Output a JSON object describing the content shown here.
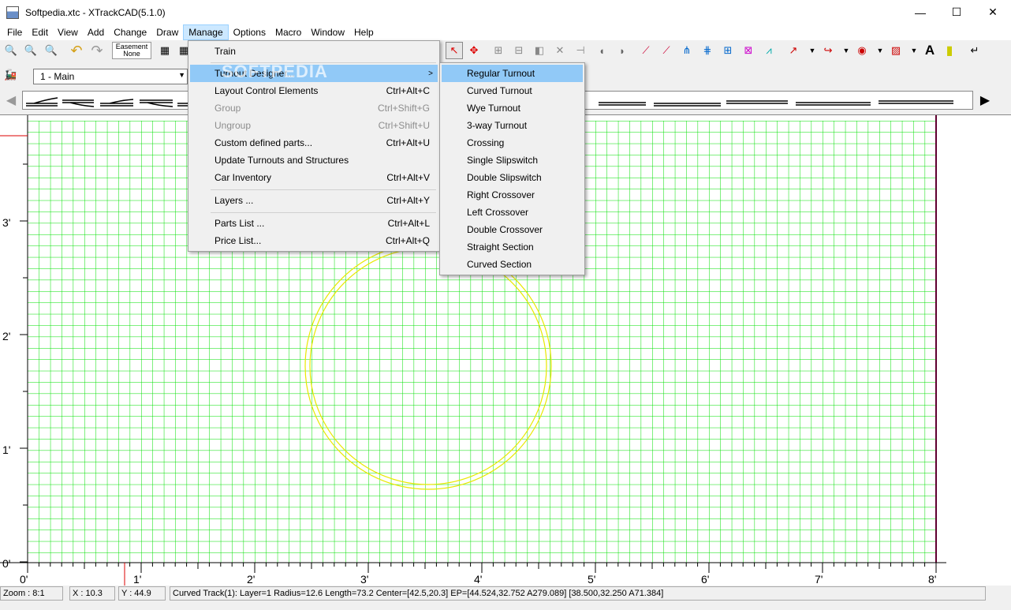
{
  "window": {
    "title": "Softpedia.xtc - XTrackCAD(5.1.0)",
    "minimize": "—",
    "maximize": "☐",
    "close": "✕"
  },
  "menubar": [
    "File",
    "Edit",
    "View",
    "Add",
    "Change",
    "Draw",
    "Manage",
    "Options",
    "Macro",
    "Window",
    "Help"
  ],
  "toolbar": {
    "easement_title": "Easement",
    "easement_value": "None"
  },
  "layer": {
    "selected": "1 - Main"
  },
  "manage_menu": {
    "items": [
      {
        "label": "Train",
        "shortcut": ""
      },
      {
        "label": "Turnout Designer...",
        "shortcut": ""
      },
      {
        "label": "Layout Control Elements",
        "shortcut": "Ctrl+Alt+C"
      },
      {
        "label": "Group",
        "shortcut": "Ctrl+Shift+G"
      },
      {
        "label": "Ungroup",
        "shortcut": "Ctrl+Shift+U"
      },
      {
        "label": "Custom defined parts...",
        "shortcut": "Ctrl+Alt+U"
      },
      {
        "label": "Update Turnouts and Structures",
        "shortcut": ""
      },
      {
        "label": "Car Inventory",
        "shortcut": "Ctrl+Alt+V"
      },
      {
        "label": "Layers ...",
        "shortcut": "Ctrl+Alt+Y"
      },
      {
        "label": "Parts List ...",
        "shortcut": "Ctrl+Alt+L"
      },
      {
        "label": "Price List...",
        "shortcut": "Ctrl+Alt+Q"
      }
    ]
  },
  "turnout_submenu": {
    "items": [
      "Regular Turnout",
      "Curved Turnout",
      "Wye Turnout",
      "3-way Turnout",
      "Crossing",
      "Single Slipswitch",
      "Double Slipswitch",
      "Right Crossover",
      "Left Crossover",
      "Double Crossover",
      "Straight Section",
      "Curved Section"
    ]
  },
  "watermark": "SOFTPEDIA",
  "ruler": {
    "y_labels": [
      "3'",
      "2'",
      "1'",
      "0'"
    ],
    "x_labels": [
      "0'",
      "1'",
      "2'",
      "3'",
      "4'",
      "5'",
      "6'",
      "7'",
      "8'"
    ]
  },
  "status": {
    "zoom": "Zoom : 8:1",
    "x": "X : 10.3",
    "y": "Y : 44.9",
    "info": "Curved Track(1): Layer=1 Radius=12.6 Length=73.2 Center=[42.5,20.3] EP=[44.524,32.752 A279.089] [38.500,32.250 A71.384]"
  },
  "colors": {
    "grid": "#00e000",
    "track": "#e8e800",
    "highlight": "#91c9f7",
    "menu_active": "#cce8ff"
  }
}
